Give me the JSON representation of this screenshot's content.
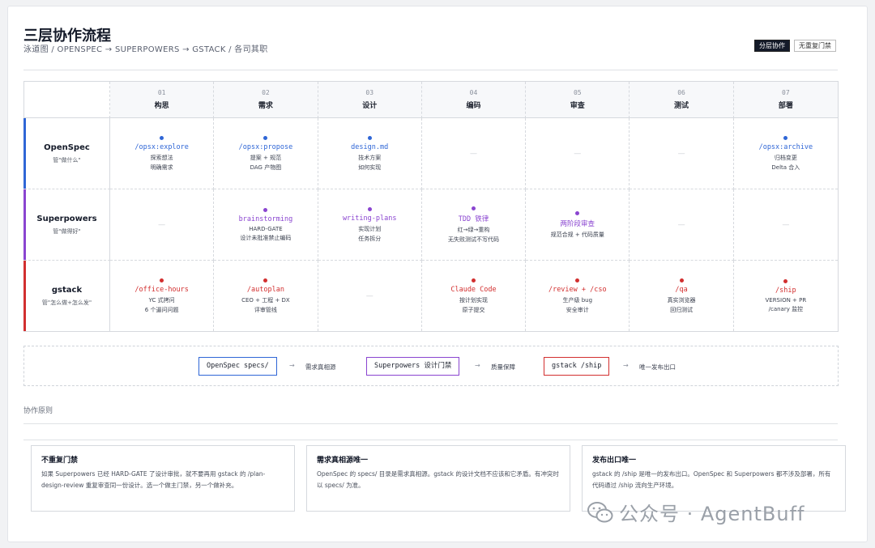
{
  "header": {
    "title": "三层协作流程",
    "subtitle": "泳道图 / OPENSPEC → SUPERPOWERS → GSTACK / 各司其职",
    "tags": [
      "分层协作",
      "无重复门禁"
    ]
  },
  "columns": [
    {
      "num": "01",
      "name": "构思"
    },
    {
      "num": "02",
      "name": "需求"
    },
    {
      "num": "03",
      "name": "设计"
    },
    {
      "num": "04",
      "name": "编码"
    },
    {
      "num": "05",
      "name": "审查"
    },
    {
      "num": "06",
      "name": "测试"
    },
    {
      "num": "07",
      "name": "部署"
    }
  ],
  "lanes": [
    {
      "name": "OpenSpec",
      "sub": "管\"做什么\"",
      "color": "#2f66d6",
      "cells": [
        {
          "cmd": "/opsx:explore",
          "d1": "探索想法",
          "d2": "明确需求"
        },
        {
          "cmd": "/opsx:propose",
          "d1": "提案 + 规范",
          "d2": "DAG 产物图"
        },
        {
          "cmd": "design.md",
          "d1": "技术方案",
          "d2": "如何实现"
        },
        null,
        null,
        null,
        {
          "cmd": "/opsx:archive",
          "d1": "归档变更",
          "d2": "Delta 合入"
        }
      ]
    },
    {
      "name": "Superpowers",
      "sub": "管\"做得好\"",
      "color": "#8a45d0",
      "cells": [
        null,
        {
          "cmd": "brainstorming",
          "d1": "HARD-GATE",
          "d2": "设计未批准禁止编码"
        },
        {
          "cmd": "writing-plans",
          "d1": "实现计划",
          "d2": "任务拆分"
        },
        {
          "cmd": "TDD 铁律",
          "d1": "红→绿→重构",
          "d2": "无失败测试不写代码"
        },
        {
          "cmd": "两阶段审查",
          "d1": "规范合规 + 代码质量",
          "d2": ""
        },
        null,
        null
      ]
    },
    {
      "name": "gstack",
      "sub": "管\"怎么做+怎么发\"",
      "color": "#d22f2f",
      "cells": [
        {
          "cmd": "/office-hours",
          "d1": "YC 式拷问",
          "d2": "6 个逼问问题"
        },
        {
          "cmd": "/autoplan",
          "d1": "CEO + 工程 + DX",
          "d2": "评审管线"
        },
        null,
        {
          "cmd": "Claude Code",
          "d1": "按计划实现",
          "d2": "原子提交"
        },
        {
          "cmd": "/review + /cso",
          "d1": "生产级 bug",
          "d2": "安全审计"
        },
        {
          "cmd": "/qa",
          "d1": "真实浏览器",
          "d2": "回归测试"
        },
        {
          "cmd": "/ship",
          "d1": "VERSION + PR",
          "d2": "/canary 监控"
        }
      ]
    }
  ],
  "empty_mark": "—",
  "flow": {
    "arrow": "→",
    "steps": [
      {
        "box": "OpenSpec specs/",
        "color": "#2f66d6",
        "label": "需求真相源"
      },
      {
        "box": "Superpowers 设计门禁",
        "color": "#8a45d0",
        "label": "质量保障"
      },
      {
        "box": "gstack /ship",
        "color": "#d22f2f",
        "label": "唯一发布出口"
      }
    ]
  },
  "principles": {
    "section_title": "协作原则",
    "cards": [
      {
        "title": "不重复门禁",
        "body": "如果 Superpowers 已经 HARD-GATE 了设计审批，就不要再用 gstack 的 /plan-design-review 重复审查同一份设计。选一个做主门禁，另一个做补充。"
      },
      {
        "title": "需求真相源唯一",
        "body": "OpenSpec 的 specs/ 目录是需求真相源。gstack 的设计文档不应该和它矛盾。有冲突时以 specs/ 为准。"
      },
      {
        "title": "发布出口唯一",
        "body": "gstack 的 /ship 是唯一的发布出口。OpenSpec 和 Superpowers 都不涉及部署，所有代码通过 /ship 流向生产环境。"
      }
    ]
  },
  "watermark": "公众号 · AgentBuff",
  "watermark_icon": "wechat-icon"
}
